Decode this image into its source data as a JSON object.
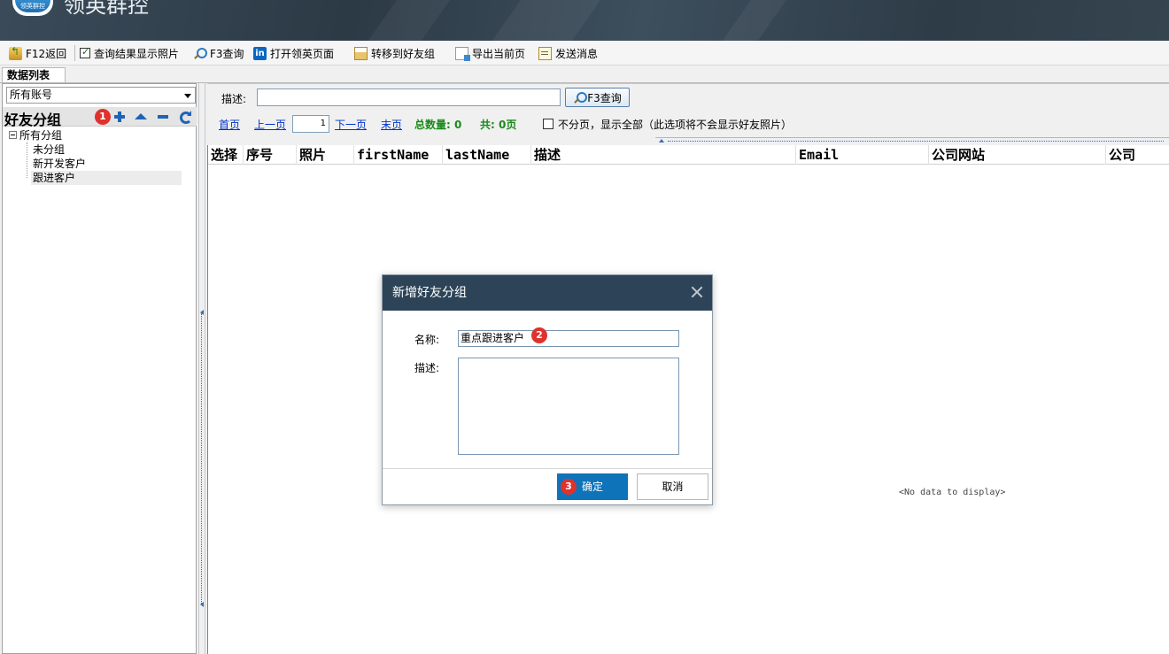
{
  "app": {
    "title": "领英群控",
    "logo_text": "领英群控"
  },
  "toolbar": {
    "back": "F12返回",
    "show_photos": "查询结果显示照片",
    "query": "F3查询",
    "open_linkedin": "打开领英页面",
    "move_group": "转移到好友组",
    "export": "导出当前页",
    "send_message": "发送消息"
  },
  "tab": {
    "label": "数据列表"
  },
  "sidebar": {
    "account_select": "所有账号",
    "group_title": "好友分组",
    "tree_root": "所有分组",
    "groups": [
      "未分组",
      "新开发客户",
      "跟进客户"
    ]
  },
  "filter": {
    "desc_label": "描述:",
    "query_button": "F3查询",
    "first": "首页",
    "prev": "上一页",
    "page": "1",
    "next": "下一页",
    "last": "末页",
    "total": "总数量: 0",
    "pages": "共: 0页",
    "no_paging": "不分页，显示全部（此选项将不会显示好友照片）"
  },
  "grid": {
    "columns": [
      "选择",
      "序号",
      "照片",
      "firstName",
      "lastName",
      "描述",
      "Email",
      "公司网站",
      "公司"
    ],
    "empty_text": "<No data to display>"
  },
  "dialog": {
    "title": "新增好友分组",
    "name_label": "名称:",
    "name_value": "重点跟进客户",
    "desc_label": "描述:",
    "ok": "确定",
    "cancel": "取消"
  },
  "annotations": {
    "badge1": "1",
    "badge2": "2",
    "badge3": "3"
  },
  "colors": {
    "banner": "#2c3a46",
    "dialog_title": "#2d4458",
    "ok_button": "#0e73b8",
    "badge": "#e0312d",
    "link": "#0033cc",
    "total_green": "#1a8a1a"
  }
}
